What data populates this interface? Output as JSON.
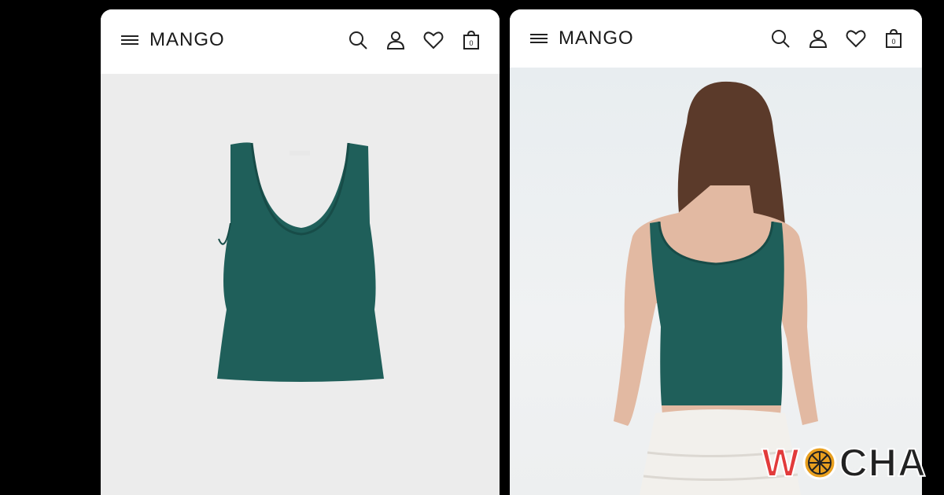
{
  "left_screen": {
    "brand": "MANGO",
    "nav_icons": [
      "menu-icon",
      "search-icon",
      "account-icon",
      "wishlist-icon",
      "bag-icon"
    ],
    "bag_count": "0"
  },
  "right_screen": {
    "brand": "MANGO",
    "nav_icons": [
      "menu-icon",
      "search-icon",
      "account-icon",
      "wishlist-icon",
      "bag-icon"
    ],
    "bag_count": "0"
  },
  "watermark": {
    "first_letter": "W",
    "rest": "CHA"
  },
  "colors": {
    "top": "#1f5f5a",
    "background": "#000000",
    "watermark_accent": "#e23b3b"
  }
}
